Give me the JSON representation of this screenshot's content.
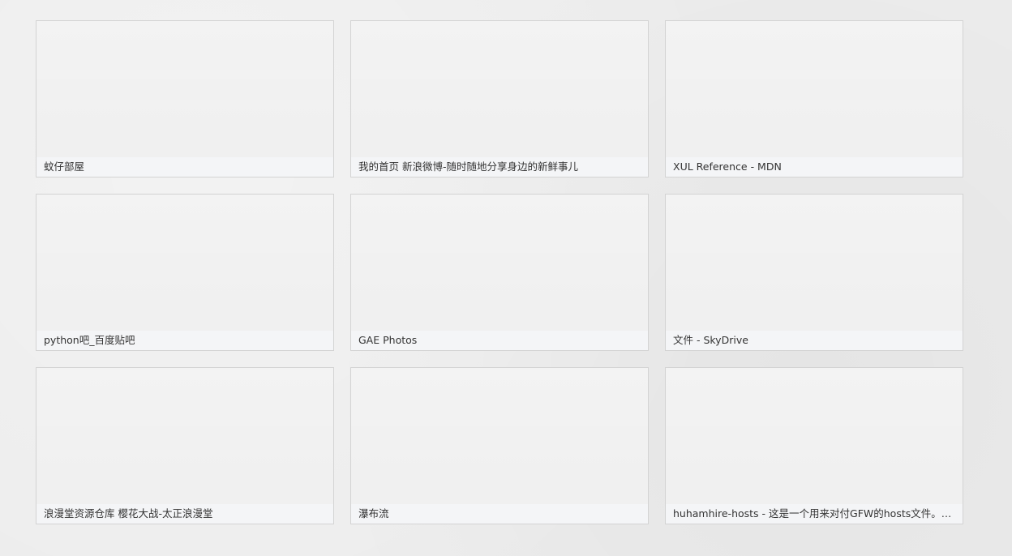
{
  "tiles": [
    {
      "title": "蚊仔部屋"
    },
    {
      "title": "我的首页 新浪微博-随时随地分享身边的新鲜事儿"
    },
    {
      "title": "XUL Reference - MDN"
    },
    {
      "title": "python吧_百度贴吧"
    },
    {
      "title": "GAE Photos"
    },
    {
      "title": "文件 - SkyDrive"
    },
    {
      "title": "浪漫堂资源仓库 樱花大战-太正浪漫堂"
    },
    {
      "title": "瀑布流"
    },
    {
      "title": "huhamhire-hosts - 这是一个用来对付GFW的hosts文件。我们..."
    }
  ]
}
